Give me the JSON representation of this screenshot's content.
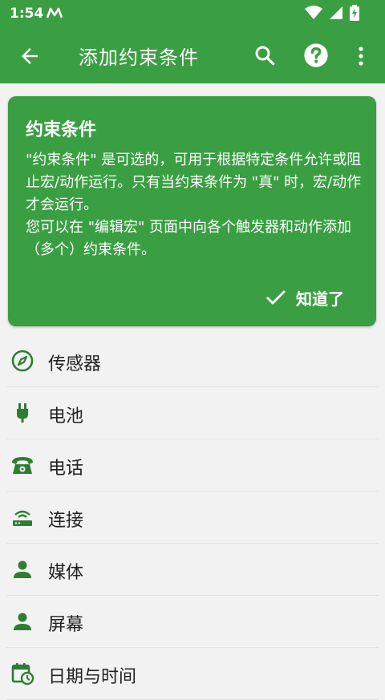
{
  "status_bar": {
    "time": "1:54"
  },
  "app_bar": {
    "title": "添加约束条件"
  },
  "info_card": {
    "heading": "约束条件",
    "body": "\"约束条件\" 是可选的，可用于根据特定条件允许或阻止宏/动作运行。只有当约束条件为 \"真\" 时，宏/动作才会运行。\n您可以在 \"编辑宏\" 页面中向各个触发器和动作添加（多个）约束条件。",
    "dismiss_label": "知道了"
  },
  "categories": [
    {
      "label": "传感器",
      "icon": "compass-icon"
    },
    {
      "label": "电池",
      "icon": "plug-icon"
    },
    {
      "label": "电话",
      "icon": "phone-icon"
    },
    {
      "label": "连接",
      "icon": "router-icon"
    },
    {
      "label": "媒体",
      "icon": "person-icon"
    },
    {
      "label": "屏幕",
      "icon": "person-icon"
    },
    {
      "label": "日期与时间",
      "icon": "calendar-clock-icon"
    }
  ],
  "colors": {
    "primary": "#3A9F42",
    "icon": "#2E7D32",
    "background": "#F2F2F2"
  }
}
